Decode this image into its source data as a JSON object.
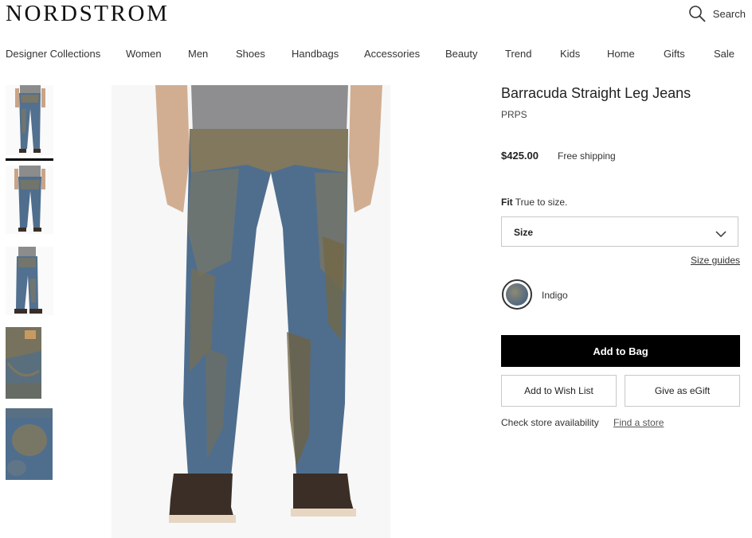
{
  "header": {
    "logo": "NORDSTROM",
    "search_label": "Search",
    "search_icon": "search-icon"
  },
  "nav": {
    "items": [
      "Designer Collections",
      "Women",
      "Men",
      "Shoes",
      "Handbags",
      "Accessories",
      "Beauty",
      "Trend",
      "Kids",
      "Home",
      "Gifts",
      "Sale"
    ]
  },
  "gallery": {
    "thumbnails": [
      "front view",
      "back view",
      "side view",
      "pocket detail",
      "fabric detail"
    ],
    "selected_index": 0
  },
  "product": {
    "title": "Barracuda Straight Leg Jeans",
    "brand": "PRPS",
    "price": "$425.00",
    "shipping": "Free shipping",
    "fit_label": "Fit",
    "fit_value": "True to size.",
    "size_label": "Size",
    "size_guides": "Size guides",
    "color_name": "Indigo",
    "add_to_bag": "Add to Bag",
    "add_to_wishlist": "Add to Wish List",
    "give_egift": "Give as eGift",
    "store_text": "Check store availability",
    "find_store": "Find a store"
  },
  "colors": {
    "primary_button": "#000000",
    "border": "#c8c8c8",
    "text": "#333333",
    "denim": "#4f6e8e",
    "mud": "#8a7a55"
  }
}
